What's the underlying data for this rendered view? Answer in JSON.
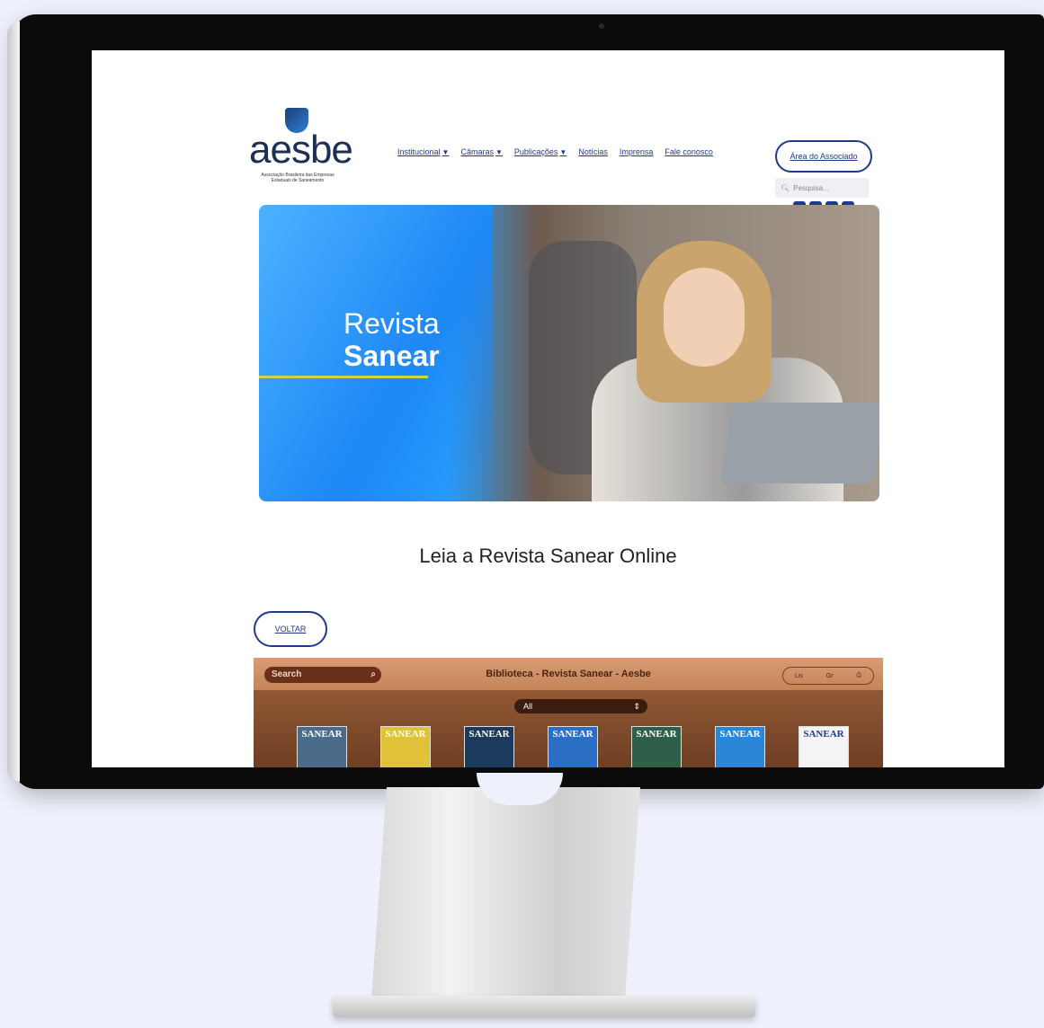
{
  "header": {
    "logo_text": "aesbe",
    "logo_subtitle": "Associação Brasileira das Empresas Estaduais de Saneamento",
    "nav": [
      {
        "label": "Institucional",
        "has_caret": true
      },
      {
        "label": "Câmaras",
        "has_caret": true
      },
      {
        "label": "Publicações",
        "has_caret": true
      },
      {
        "label": "Notícias",
        "has_caret": false
      },
      {
        "label": "Imprensa",
        "has_caret": false
      },
      {
        "label": "Fale conosco",
        "has_caret": false
      }
    ],
    "caret": "▼",
    "associate_button": "Área do Associado",
    "search_placeholder": "Pesquisa...",
    "social_icons": [
      "instagram-icon",
      "facebook-icon",
      "youtube-icon",
      "linkedin-icon"
    ],
    "social_glyphs": [
      "◎",
      "f",
      "▶",
      "in"
    ]
  },
  "banner": {
    "title_light": "Revista",
    "title_bold": "Sanear"
  },
  "headline": "Leia a Revista Sanear Online",
  "back_button": "VOLTAR",
  "library": {
    "search_label": "Search",
    "title": "Biblioteca - Revista Sanear - Aesbe",
    "controls": [
      "Lis",
      "Gr"
    ],
    "filter_value": "All",
    "books": [
      {
        "title": "SANEAR",
        "color": "#4a6b8a"
      },
      {
        "title": "SANEAR",
        "color": "#e0c23a"
      },
      {
        "title": "SANEAR",
        "color": "#1c3a5c"
      },
      {
        "title": "SANEAR",
        "color": "#2a6fc4"
      },
      {
        "title": "SANEAR",
        "color": "#2f5f4a"
      },
      {
        "title": "SANEAR",
        "color": "#2b86d8"
      },
      {
        "title": "SANEAR",
        "color": "#f4f4f4"
      }
    ]
  }
}
